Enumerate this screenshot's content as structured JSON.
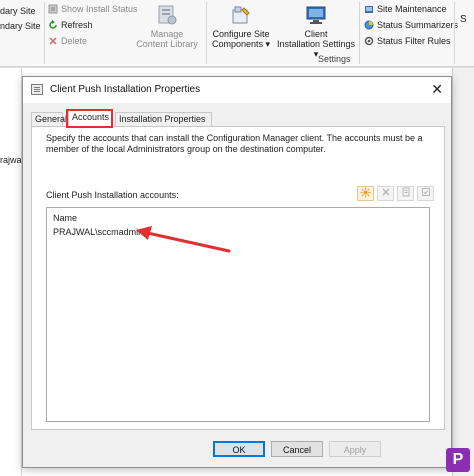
{
  "ribbon": {
    "left_items": [
      {
        "label": "dary Site",
        "icon": "site-icon",
        "grayed": false
      },
      {
        "label": "ndary Site",
        "icon": "site-icon",
        "grayed": false
      }
    ],
    "status_items": [
      {
        "label": "Show Install Status",
        "icon": "status-icon",
        "grayed": true
      },
      {
        "label": "Refresh",
        "icon": "refresh-icon",
        "grayed": false
      },
      {
        "label": "Delete",
        "icon": "delete-icon",
        "grayed": true
      }
    ],
    "manage_content_library": "Manage\nContent Library",
    "configure_site_components": "Configure Site\nComponents",
    "client_installation_settings": "Client\nInstallation Settings",
    "settings_group_label": "Settings",
    "right_items": [
      {
        "label": "Site Maintenance",
        "icon": "maintenance-icon"
      },
      {
        "label": "Status Summarizers",
        "icon": "summarizer-icon"
      },
      {
        "label": "Status Filter Rules",
        "icon": "filter-rules-icon"
      }
    ]
  },
  "background": {
    "left_text": "rajwal"
  },
  "dialog": {
    "title": "Client Push Installation Properties",
    "close_label": "✕",
    "tabs": [
      {
        "label": "General",
        "active": false
      },
      {
        "label": "Accounts",
        "active": true
      },
      {
        "label": "Installation Properties",
        "active": false
      }
    ],
    "description": "Specify the accounts that can install the Configuration Manager client. The accounts must be a member of the local Administrators group on the destination computer.",
    "accounts_label": "Client Push Installation accounts:",
    "toolbar_icons": [
      "new-account-icon",
      "delete-account-icon",
      "properties-icon",
      "verify-icon"
    ],
    "list": {
      "header": "Name",
      "rows": [
        "PRAJWAL\\sccmadmin"
      ]
    },
    "buttons": {
      "ok": "OK",
      "cancel": "Cancel",
      "apply": "Apply"
    }
  },
  "watermark": {
    "logo_letter": "P"
  },
  "colors": {
    "highlight_red": "#e03030",
    "accent_blue": "#0078d7",
    "logo_purple": "#8b2eb4"
  }
}
